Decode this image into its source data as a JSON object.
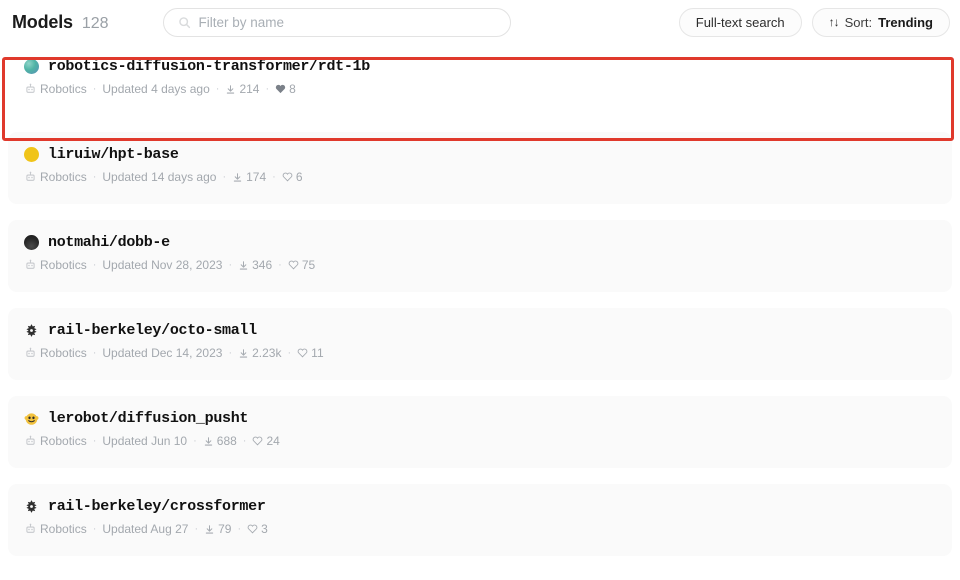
{
  "header": {
    "title": "Models",
    "count": "128",
    "filter": {
      "placeholder": "Filter by name",
      "value": "",
      "icon": "search-icon"
    },
    "fulltext_label": "Full-text search",
    "sort": {
      "icon": "sort-arrows-icon",
      "label": "Sort:",
      "value": "Trending"
    }
  },
  "annotation": {
    "color": "#e0392c",
    "target": "robotics-diffusion-transformer/rdt-1b"
  },
  "models": [
    {
      "name": "robotics-diffusion-transformer/rdt-1b",
      "avatar": "teal-gradient-circle",
      "task": "Robotics",
      "task_icon": "robot-icon",
      "updated": "Updated 4 days ago",
      "downloads": "214",
      "downloads_icon": "download-icon",
      "likes": "8",
      "likes_icon": "heart-filled-icon",
      "highlighted": true
    },
    {
      "name": "liruiw/hpt-base",
      "avatar": "gold-circle",
      "task": "Robotics",
      "task_icon": "robot-icon",
      "updated": "Updated 14 days ago",
      "downloads": "174",
      "downloads_icon": "download-icon",
      "likes": "6",
      "likes_icon": "heart-outline-icon",
      "highlighted": false
    },
    {
      "name": "notmahi/dobb-e",
      "avatar": "dark-circle",
      "task": "Robotics",
      "task_icon": "robot-icon",
      "updated": "Updated Nov 28, 2023",
      "downloads": "346",
      "downloads_icon": "download-icon",
      "likes": "75",
      "likes_icon": "heart-outline-icon",
      "highlighted": false
    },
    {
      "name": "rail-berkeley/octo-small",
      "avatar": "berkeley-rail-logo",
      "task": "Robotics",
      "task_icon": "robot-icon",
      "updated": "Updated Dec 14, 2023",
      "downloads": "2.23k",
      "downloads_icon": "download-icon",
      "likes": "11",
      "likes_icon": "heart-outline-icon",
      "highlighted": false
    },
    {
      "name": "lerobot/diffusion_pusht",
      "avatar": "hugging-face-emoji",
      "task": "Robotics",
      "task_icon": "robot-icon",
      "updated": "Updated Jun 10",
      "downloads": "688",
      "downloads_icon": "download-icon",
      "likes": "24",
      "likes_icon": "heart-outline-icon",
      "highlighted": false
    },
    {
      "name": "rail-berkeley/crossformer",
      "avatar": "berkeley-rail-logo",
      "task": "Robotics",
      "task_icon": "robot-icon",
      "updated": "Updated Aug 27",
      "downloads": "79",
      "downloads_icon": "download-icon",
      "likes": "3",
      "likes_icon": "heart-outline-icon",
      "highlighted": false
    }
  ]
}
